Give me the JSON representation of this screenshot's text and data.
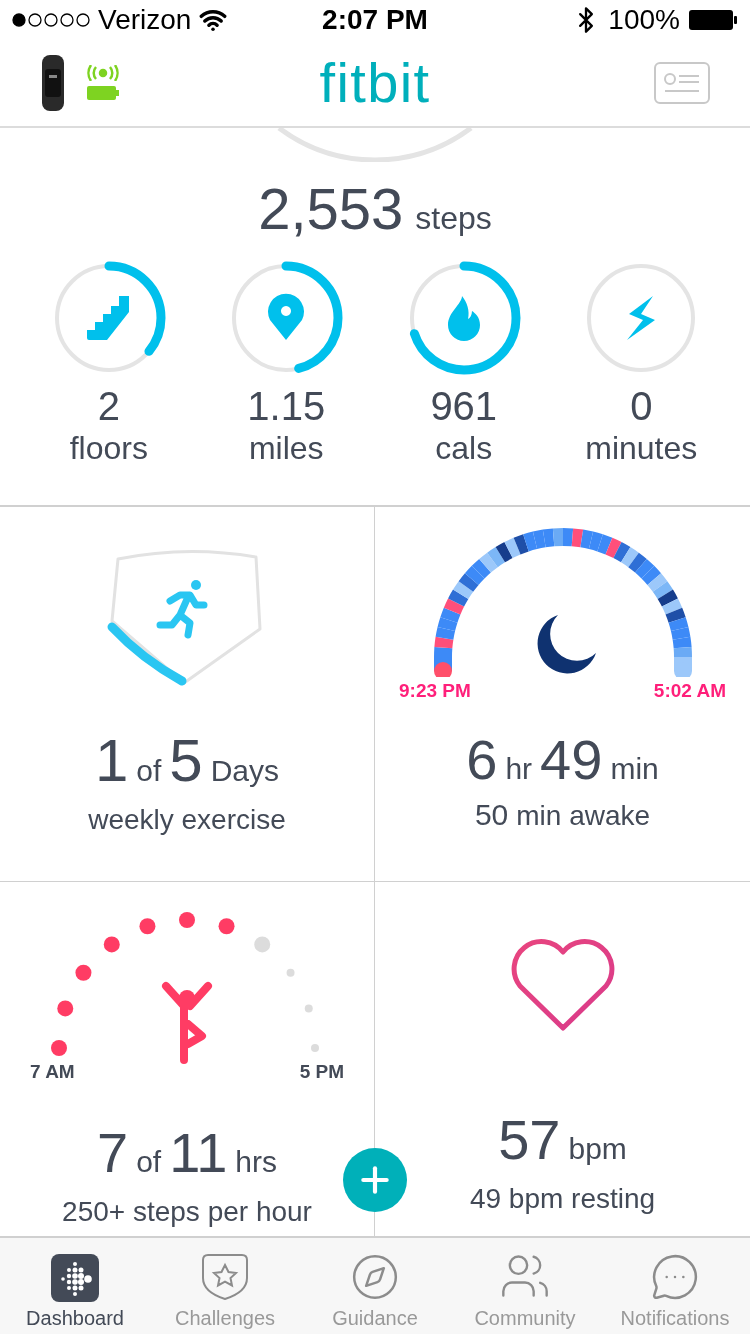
{
  "status_bar": {
    "carrier": "Verizon",
    "time": "2:07 PM",
    "battery": "100%"
  },
  "header": {
    "logo": "fitbit"
  },
  "steps": {
    "value": "2,553",
    "unit": "steps"
  },
  "stats": [
    {
      "kind": "floors",
      "value": "2",
      "label": "floors"
    },
    {
      "kind": "distance",
      "value": "1.15",
      "label": "miles"
    },
    {
      "kind": "calories",
      "value": "961",
      "label": "cals"
    },
    {
      "kind": "active",
      "value": "0",
      "label": "minutes"
    }
  ],
  "exercise": {
    "parts": [
      {
        "kind": "number",
        "text": "1"
      },
      {
        "kind": "unit",
        "text": "of"
      },
      {
        "kind": "number",
        "text": "5"
      },
      {
        "kind": "unit",
        "text": "Days"
      }
    ],
    "caption": "weekly exercise"
  },
  "sleep": {
    "start": "9:23 PM",
    "end": "5:02 AM",
    "parts": [
      {
        "kind": "number",
        "text": "6"
      },
      {
        "kind": "unit",
        "text": "hr"
      },
      {
        "kind": "number",
        "text": "49"
      },
      {
        "kind": "unit",
        "text": "min"
      }
    ],
    "caption_parts": [
      {
        "kind": "number",
        "text": "50"
      },
      {
        "kind": "unit",
        "text": "min awake"
      }
    ]
  },
  "hourly": {
    "start": "7 AM",
    "end": "5 PM",
    "hours": [
      {
        "kind": "past",
        "met": true
      },
      {
        "kind": "past",
        "met": true
      },
      {
        "kind": "past",
        "met": true
      },
      {
        "kind": "past",
        "met": true
      },
      {
        "kind": "past",
        "met": true
      },
      {
        "kind": "past",
        "met": true
      },
      {
        "kind": "past",
        "met": true
      },
      {
        "kind": "current",
        "met": false
      },
      {
        "kind": "future",
        "met": false
      },
      {
        "kind": "future",
        "met": false
      },
      {
        "kind": "future",
        "met": false
      }
    ],
    "parts": [
      {
        "kind": "number",
        "text": "7"
      },
      {
        "kind": "unit",
        "text": "of"
      },
      {
        "kind": "number",
        "text": "11"
      },
      {
        "kind": "unit",
        "text": "hrs"
      }
    ],
    "caption": "250+ steps per hour"
  },
  "heart": {
    "parts": [
      {
        "kind": "number",
        "text": "57"
      },
      {
        "kind": "unit",
        "text": "bpm"
      }
    ],
    "caption": "49 bpm resting"
  },
  "tabs": [
    {
      "kind": "dashboard",
      "label": "Dashboard",
      "selected": true
    },
    {
      "kind": "challenges",
      "label": "Challenges",
      "selected": false
    },
    {
      "kind": "guidance",
      "label": "Guidance",
      "selected": false
    },
    {
      "kind": "community",
      "label": "Community",
      "selected": false
    },
    {
      "kind": "notifications",
      "label": "Notifications",
      "selected": false
    }
  ]
}
